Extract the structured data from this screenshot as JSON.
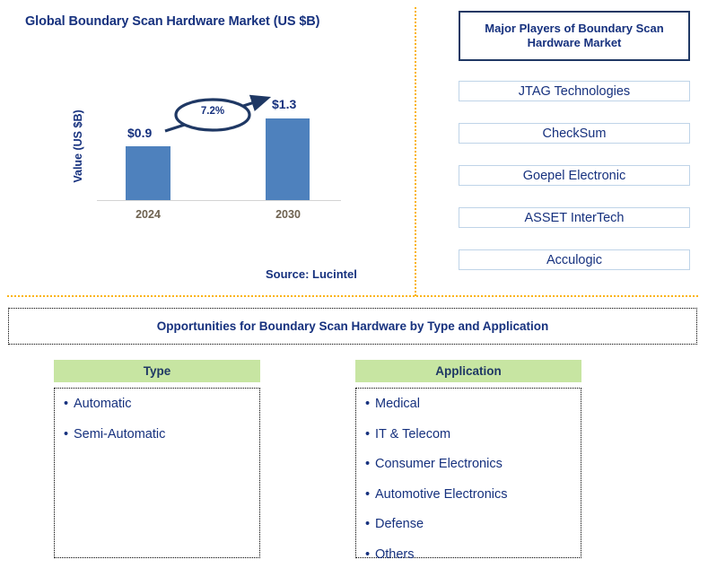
{
  "chart_panel": {
    "title": "Global Boundary Scan Hardware Market (US $B)",
    "y_axis_label": "Value (US $B)",
    "cagr_label": "7.2%",
    "source": "Source: Lucintel"
  },
  "chart_data": {
    "type": "bar",
    "title": "Global Boundary Scan Hardware Market (US $B)",
    "categories": [
      "2024",
      "2030"
    ],
    "values": [
      0.9,
      1.3
    ],
    "value_labels": [
      "$0.9",
      "$1.3"
    ],
    "xlabel": "",
    "ylabel": "Value (US $B)",
    "ylim": [
      0,
      1.45
    ],
    "grid": false,
    "legend": "none",
    "series_color": "#4E81BD",
    "annotations": [
      {
        "text": "7.2%",
        "note": "CAGR arrow from 2024 bar to 2030 bar"
      }
    ],
    "source": "Source: Lucintel"
  },
  "players_panel": {
    "header": "Major Players of Boundary Scan Hardware Market",
    "items": [
      {
        "label": "JTAG Technologies"
      },
      {
        "label": "CheckSum"
      },
      {
        "label": "Goepel Electronic"
      },
      {
        "label": "ASSET InterTech"
      },
      {
        "label": "Acculogic"
      }
    ]
  },
  "opportunities": {
    "banner": "Opportunities for Boundary Scan Hardware by Type and Application",
    "columns": [
      {
        "header": "Type",
        "items": [
          "Automatic",
          "Semi-Automatic"
        ]
      },
      {
        "header": "Application",
        "items": [
          "Medical",
          "IT & Telecom",
          "Consumer Electronics",
          "Automotive Electronics",
          "Defense",
          "Others"
        ]
      }
    ]
  },
  "colors": {
    "bar": "#4E81BD",
    "navy_text": "#16317E",
    "divider_orange": "#FBB415",
    "header_green": "#C7E5A2",
    "box_border_navy": "#1F3864",
    "player_border": "#BFD4E8",
    "category_text": "#6E6250"
  },
  "bullet": "•"
}
